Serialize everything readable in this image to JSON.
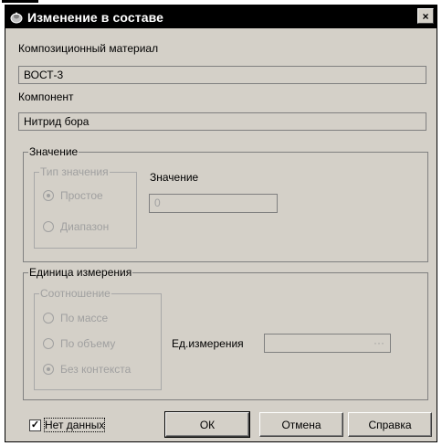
{
  "window": {
    "title": "Изменение в составе",
    "close_symbol": "×"
  },
  "composite": {
    "label": "Композиционный материал",
    "value": "ВОСТ-3"
  },
  "component": {
    "label": "Компонент",
    "value": "Нитрид бора"
  },
  "value_group": {
    "title": "Значение",
    "type_group": {
      "title": "Тип значения",
      "options": [
        {
          "label": "Простое",
          "selected": true
        },
        {
          "label": "Диапазон",
          "selected": false
        }
      ]
    },
    "value_label": "Значение",
    "value": "0"
  },
  "unit_group": {
    "title": "Единица измерения",
    "ratio_group": {
      "title": "Соотношение",
      "options": [
        {
          "label": "По массе",
          "selected": false
        },
        {
          "label": "По объему",
          "selected": false
        },
        {
          "label": "Без контекста",
          "selected": true
        }
      ]
    },
    "unit_label": "Ед.измерения",
    "unit_value": "",
    "unit_button": "···"
  },
  "no_data": {
    "label": "Нет данных",
    "checked": true,
    "check_mark": "✓"
  },
  "buttons": {
    "ok": "ОК",
    "cancel": "Отмена",
    "help": "Справка"
  }
}
